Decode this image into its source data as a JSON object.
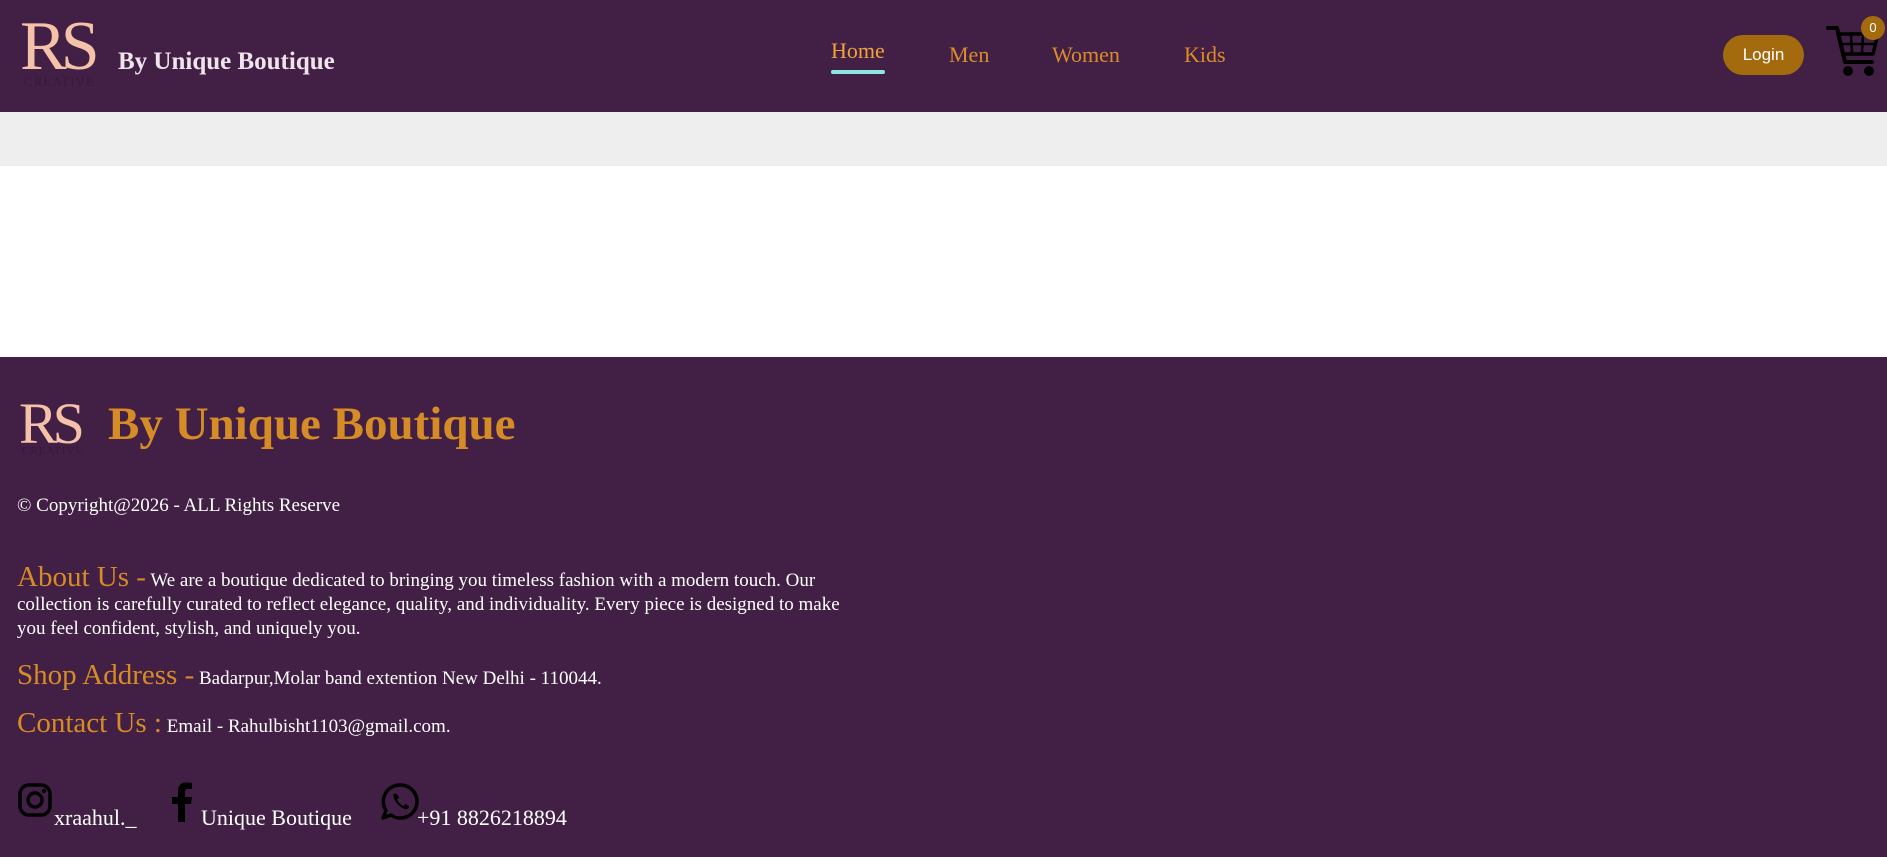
{
  "header": {
    "logo_text": "RS",
    "logo_subtext": "CREATIVE",
    "brand": "By Unique Boutique",
    "nav": [
      {
        "label": "Home",
        "active": true
      },
      {
        "label": "Men",
        "active": false
      },
      {
        "label": "Women",
        "active": false
      },
      {
        "label": "Kids",
        "active": false
      }
    ],
    "login_label": "Login",
    "cart_count": "0",
    "cart_icon": "cart-icon"
  },
  "footer": {
    "logo_text": "RS",
    "logo_subtext": "CREATIVE",
    "brand": "By Unique Boutique",
    "copyright": "© Copyright@2026 - ALL Rights Reserve",
    "about_title": "About Us -",
    "about_text": "We are a boutique dedicated to bringing you timeless fashion with a modern touch. Our collection is carefully curated to reflect elegance, quality, and individuality. Every piece is designed to make you feel confident, stylish, and uniquely you.",
    "address_title": "Shop Address -",
    "address_text": "Badarpur,Molar band extention New Delhi - 110044.",
    "contact_title": "Contact Us :",
    "contact_text": "Email - Rahulbisht1103@gmail.com.",
    "social": [
      {
        "icon": "instagram-icon",
        "label": "xraahul._"
      },
      {
        "icon": "facebook-icon",
        "label": "Unique Boutique"
      },
      {
        "icon": "whatsapp-icon",
        "label": "+91 8826218894"
      }
    ]
  },
  "colors": {
    "brand_purple": "#421f44",
    "accent_gold": "#d68c26",
    "login_button": "#a46b0e",
    "active_underline": "#8fe6df",
    "logo_peach": "#f3c2a8"
  }
}
